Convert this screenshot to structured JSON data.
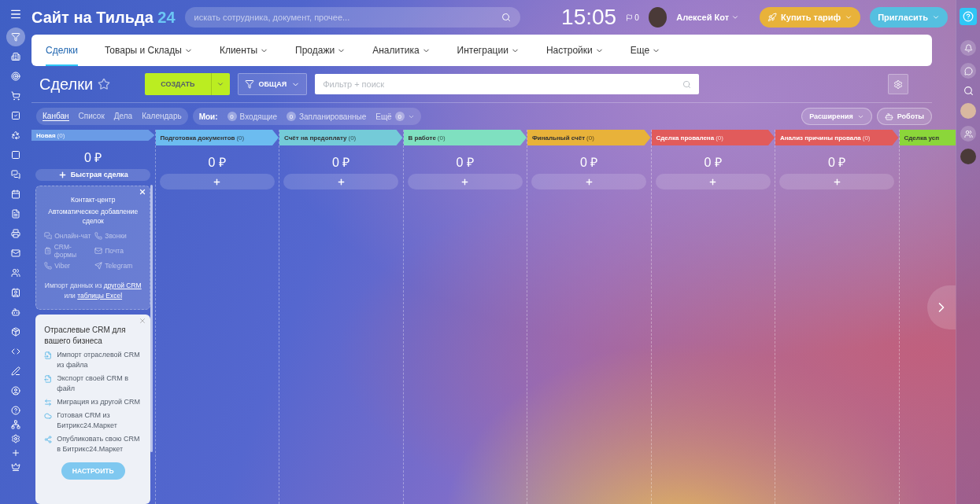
{
  "header": {
    "title": "Сайт на Тильда",
    "title_suffix": "24",
    "search_placeholder": "искать сотрудника, документ, прочее...",
    "time": "15:05",
    "flag_count": "0",
    "user_name": "Алексей Кот",
    "buy_button": "Купить тариф",
    "invite_button": "Пригласить"
  },
  "sidebar": {
    "items": [
      {
        "selected": true
      },
      {
        "selected": false
      },
      {
        "selected": false
      },
      {
        "selected": false
      },
      {
        "selected": false
      },
      {
        "selected": false
      },
      {
        "selected": false
      },
      {
        "selected": false
      },
      {
        "selected": false
      },
      {
        "selected": false
      },
      {
        "selected": false
      },
      {
        "selected": false
      },
      {
        "selected": false
      },
      {
        "selected": false
      },
      {
        "selected": false
      },
      {
        "selected": false
      },
      {
        "selected": false
      },
      {
        "selected": false
      },
      {
        "selected": false
      }
    ]
  },
  "nav": [
    {
      "label": "Сделки",
      "selected": true,
      "has_menu": false
    },
    {
      "label": "Товары и Склады",
      "selected": false,
      "has_menu": true
    },
    {
      "label": "Клиенты",
      "selected": false,
      "has_menu": true
    },
    {
      "label": "Продажи",
      "selected": false,
      "has_menu": true
    },
    {
      "label": "Аналитика",
      "selected": false,
      "has_menu": true
    },
    {
      "label": "Интеграции",
      "selected": false,
      "has_menu": true
    },
    {
      "label": "Настройки",
      "selected": false,
      "has_menu": true
    },
    {
      "label": "Еще",
      "selected": false,
      "has_menu": true
    }
  ],
  "toolbar": {
    "title": "Сделки",
    "create_button": "СОЗДАТЬ",
    "filter_preset": "ОБЩАЯ",
    "filter_placeholder": "Фильтр + поиск"
  },
  "views": [
    {
      "label": "Канбан",
      "selected": true
    },
    {
      "label": "Список",
      "selected": false
    },
    {
      "label": "Дела",
      "selected": false
    },
    {
      "label": "Календарь",
      "selected": false
    }
  ],
  "counters": {
    "label": "Мои:",
    "items": [
      {
        "count": "0",
        "label": "Входящие",
        "kind": "before"
      },
      {
        "count": "0",
        "label": "Запланированные",
        "kind": "before"
      },
      {
        "count": "0",
        "label": "Ещё",
        "kind": "after"
      }
    ]
  },
  "extensions_button": "Расширения",
  "robots_button": "Роботы",
  "stages": [
    {
      "name": "Новая",
      "count": "(0)",
      "color": "#6a9be6",
      "amount": "0 ₽",
      "add_label": "Быстрая сделка"
    },
    {
      "name": "Подготовка документов",
      "count": "(0)",
      "color": "#6cbcf0",
      "amount": "0 ₽"
    },
    {
      "name": "Счёт на предоплату",
      "count": "(0)",
      "color": "#74cbd8",
      "amount": "0 ₽"
    },
    {
      "name": "В работе",
      "count": "(0)",
      "color": "#7fe0c0",
      "amount": "0 ₽"
    },
    {
      "name": "Финальный счёт",
      "count": "(0)",
      "color": "#e8b23a",
      "amount": "0 ₽"
    },
    {
      "name": "Сделка провалена",
      "count": "(0)",
      "color": "#e15b5b",
      "amount": "0 ₽"
    },
    {
      "name": "Анализ причины провала",
      "count": "(0)",
      "color": "#e15b5b",
      "amount": "0 ₽"
    },
    {
      "name": "Сделка усп",
      "color": "#8bd63a"
    }
  ],
  "contact_card": {
    "title": "Контакт-центр",
    "subtitle": "Автоматическое добавление сделок",
    "channels": [
      "Онлайн-чат",
      "Звонки",
      "CRM-формы",
      "Почта",
      "Viber",
      "Telegram"
    ],
    "import_before": "Импорт данных из",
    "import_link1": "другой CRM",
    "import_middle": "или",
    "import_link2": "таблицы Excel"
  },
  "industry_card": {
    "title": "Отраслевые CRM для вашего бизнеса",
    "items": [
      "Импорт отраслевой CRM из файла",
      "Экспорт своей CRM в файл",
      "Миграция из другой CRM",
      "Готовая CRM из Битрикс24.Маркет",
      "Опубликовать свою CRM в Битрикс24.Маркет"
    ],
    "button": "НАСТРОИТЬ"
  }
}
